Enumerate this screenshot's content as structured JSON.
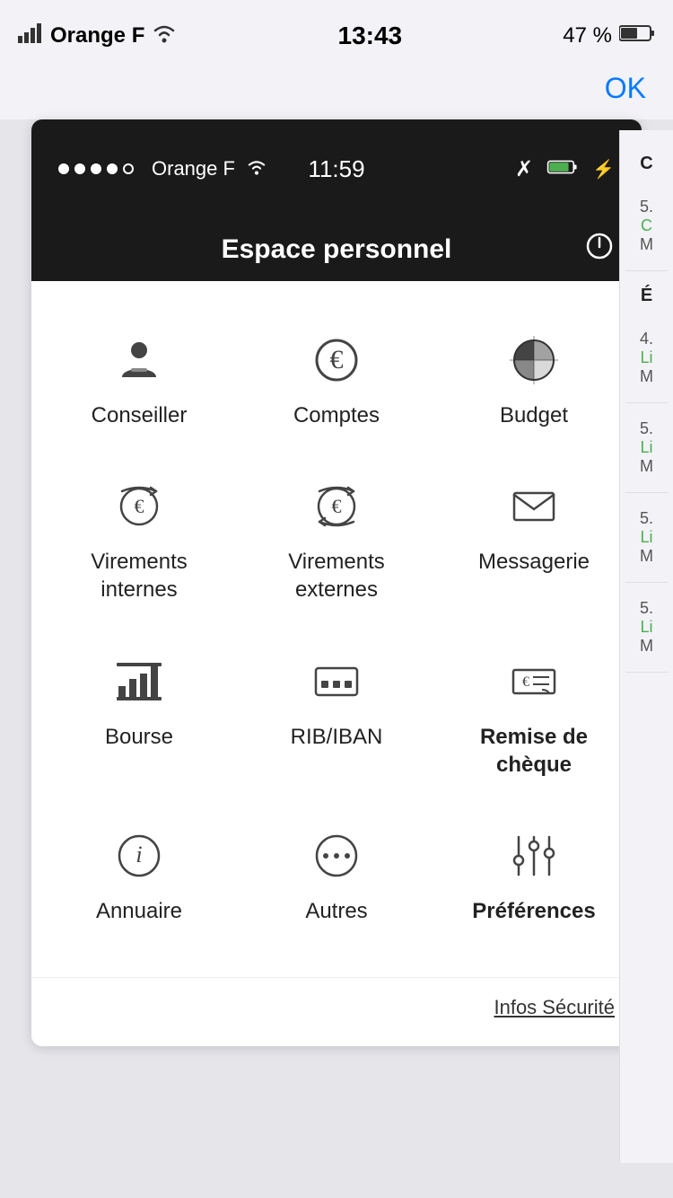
{
  "statusBar": {
    "carrier": "Orange F",
    "wifi": "wifi",
    "time": "13:43",
    "battery": "47 %",
    "signal": "▂▄▆"
  },
  "okButton": {
    "label": "OK"
  },
  "appStatusBar": {
    "dots": [
      "●",
      "●",
      "●",
      "●",
      "○"
    ],
    "carrier": "Orange F",
    "time": "11:59"
  },
  "appHeader": {
    "title": "Espace personnel",
    "powerIcon": "⏻"
  },
  "menu": {
    "items": [
      {
        "id": "conseiller",
        "label": "Conseiller",
        "bold": false
      },
      {
        "id": "comptes",
        "label": "Comptes",
        "bold": false
      },
      {
        "id": "budget",
        "label": "Budget",
        "bold": false
      },
      {
        "id": "virements-internes",
        "label": "Virements\ninternes",
        "bold": false
      },
      {
        "id": "virements-externes",
        "label": "Virements\nexternes",
        "bold": false
      },
      {
        "id": "messagerie",
        "label": "Messagerie",
        "bold": false
      },
      {
        "id": "bourse",
        "label": "Bourse",
        "bold": false
      },
      {
        "id": "rib-iban",
        "label": "RIB/IBAN",
        "bold": false
      },
      {
        "id": "remise-cheque",
        "label": "Remise de\nchèque",
        "bold": true
      },
      {
        "id": "annuaire",
        "label": "Annuaire",
        "bold": false
      },
      {
        "id": "autres",
        "label": "Autres",
        "bold": false
      },
      {
        "id": "preferences",
        "label": "Préférences",
        "bold": true
      }
    ]
  },
  "footer": {
    "securityLink": "Infos Sécurité"
  },
  "rightPanel": {
    "header": "C",
    "items": [
      {
        "number": "5.",
        "label": "C",
        "sub": "M",
        "color": "green"
      },
      {
        "header": "É"
      },
      {
        "number": "4.",
        "label": "Li",
        "sub": "M",
        "color": "green"
      },
      {
        "number": "5.",
        "label": "Li",
        "sub": "M",
        "color": "green"
      },
      {
        "number": "5.",
        "label": "Li",
        "sub": "M",
        "color": "green"
      },
      {
        "number": "5.",
        "label": "Li",
        "sub": "M",
        "color": "green"
      }
    ]
  }
}
